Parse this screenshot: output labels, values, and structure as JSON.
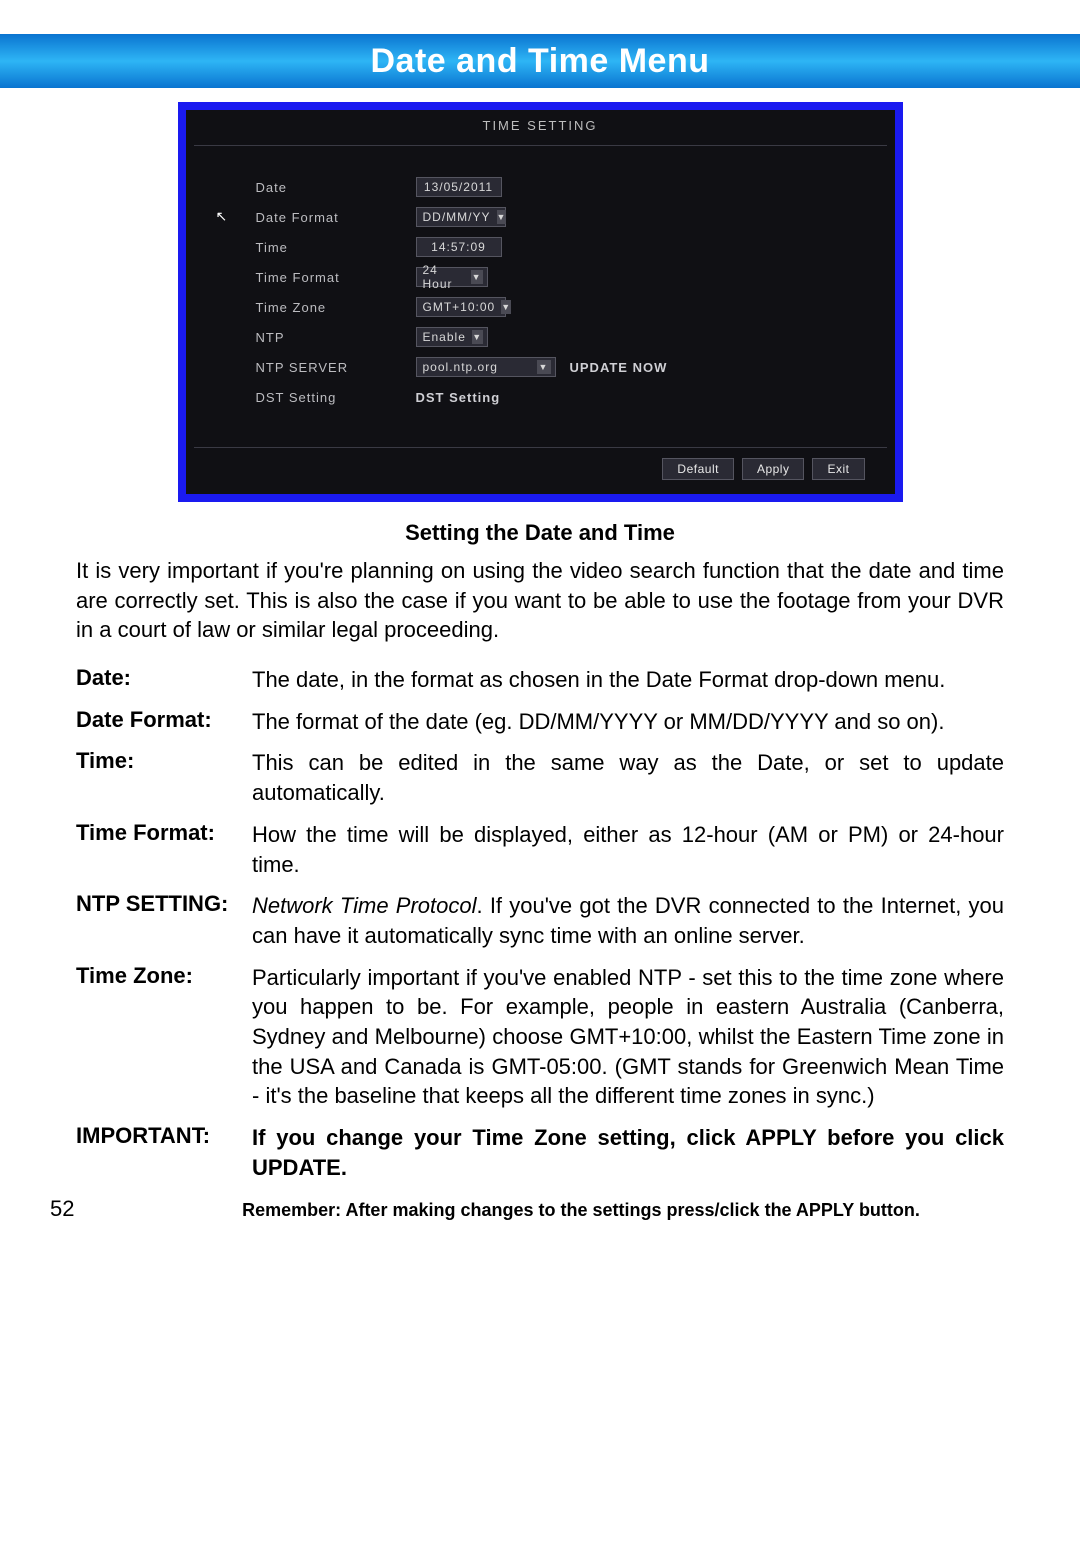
{
  "banner": {
    "title": "Date and Time Menu"
  },
  "dvr": {
    "header": "TIME SETTING",
    "rows": {
      "date_label": "Date",
      "date_value": "13/05/2011",
      "dateformat_label": "Date Format",
      "dateformat_value": "DD/MM/YY",
      "time_label": "Time",
      "time_value": "14:57:09",
      "timeformat_label": "Time Format",
      "timeformat_value": "24 Hour",
      "timezone_label": "Time Zone",
      "timezone_value": "GMT+10:00",
      "ntp_label": "NTP",
      "ntp_value": "Enable",
      "ntpserver_label": "NTP SERVER",
      "ntpserver_value": "pool.ntp.org",
      "update_now": "UPDATE NOW",
      "dst_label": "DST Setting",
      "dst_button": "DST Setting"
    },
    "footer": {
      "default": "Default",
      "apply": "Apply",
      "exit": "Exit"
    }
  },
  "section": {
    "subhead": "Setting the Date and Time",
    "intro": "It is very important if you're planning on using the video search function that the date and time are correctly set. This is also the case if you want to be able to use the footage from your DVR in a court of law or similar legal proceeding."
  },
  "defs": {
    "date_t": "Date:",
    "date_b": "The date, in the format as chosen in the Date Format drop-down menu.",
    "dateformat_t": "Date Format:",
    "dateformat_b": "The format of the date (eg. DD/MM/YYYY or MM/DD/YYYY and so on).",
    "time_t": "Time:",
    "time_b": "This can be edited in the same way as the Date, or set to update automatically.",
    "timeformat_t": "Time Format:",
    "timeformat_b": "How the time will be displayed, either as 12-hour (AM or PM) or 24-hour time.",
    "ntp_t": "NTP SETTING:",
    "ntp_b_italic": "Network Time Protocol",
    "ntp_b_rest": ". If you've got the DVR connected to the Internet, you can have it automatically sync time with an online server.",
    "tz_t": "Time Zone:",
    "tz_b": "Particularly important if you've enabled NTP - set this to the time zone where you happen to be. For example, people in eastern Australia (Canberra, Sydney and Melbourne) choose GMT+10:00, whilst the Eastern Time zone in the USA and Canada is GMT-05:00. (GMT stands for Greenwich Mean Time - it's the baseline that keeps all the different time zones in sync.)",
    "imp_t": "IMPORTANT:",
    "imp_b": "If you change your Time Zone setting, click APPLY before you click UPDATE."
  },
  "footer": {
    "page": "52",
    "reminder": "Remember: After making changes to the settings press/click the APPLY button."
  }
}
